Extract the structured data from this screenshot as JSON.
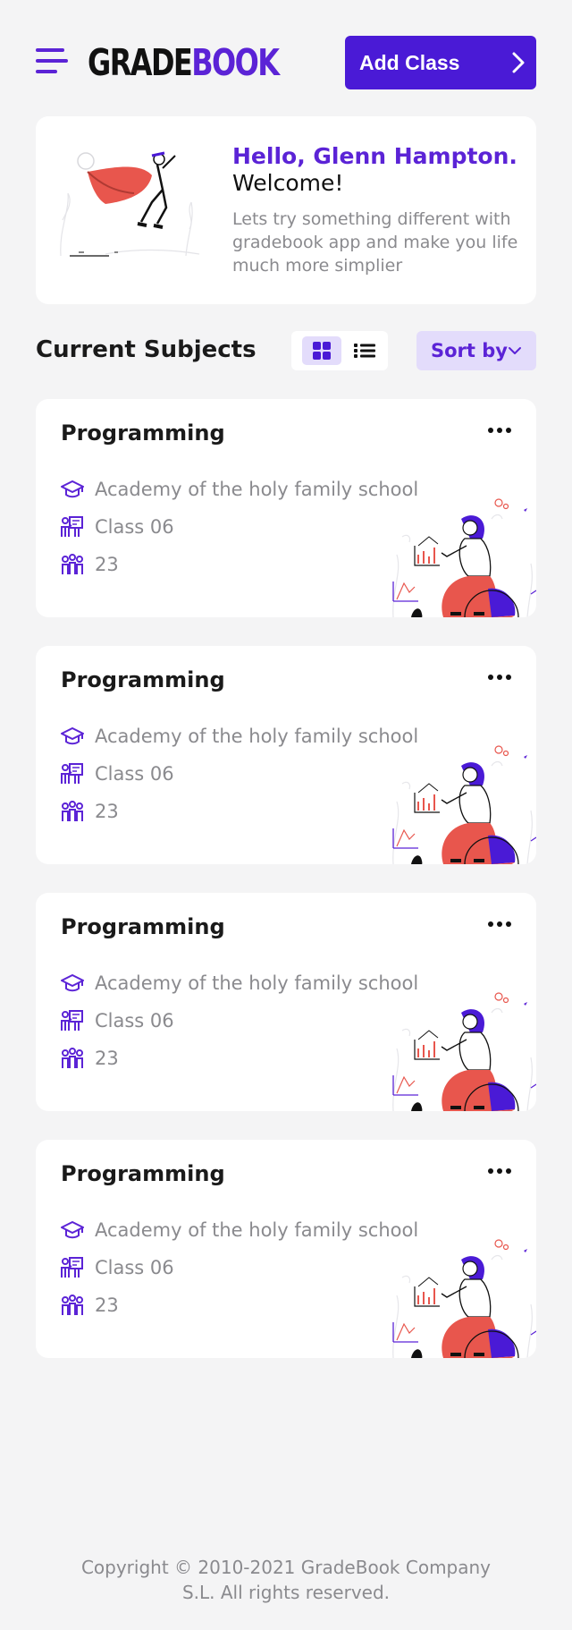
{
  "header": {
    "logo_part1": "GRADE",
    "logo_part2": "BOOK",
    "add_class_label": "Add Class"
  },
  "welcome": {
    "greeting": "Hello, Glenn Hampton.",
    "subtitle": "Welcome!",
    "description": "Lets try something different with gradebook app and make you life much more simplier"
  },
  "subjects": {
    "title": "Current Subjects",
    "sort_label": "Sort by",
    "active_view": "grid",
    "cards": [
      {
        "title": "Programming",
        "school": "Academy of the holy family school",
        "class": "Class 06",
        "students": "23"
      },
      {
        "title": "Programming",
        "school": "Academy of the holy family school",
        "class": "Class 06",
        "students": "23"
      },
      {
        "title": "Programming",
        "school": "Academy of the holy family school",
        "class": "Class 06",
        "students": "23"
      },
      {
        "title": "Programming",
        "school": "Academy of the holy family school",
        "class": "Class 06",
        "students": "23"
      }
    ]
  },
  "footer": {
    "line1": "Copyright © 2010-2021 GradeBook Company",
    "line2": "S.L. All rights reserved."
  },
  "icons": {
    "menu": "hamburger-menu-icon",
    "add_arrow": "chevron-right-icon",
    "grid": "grid-view-icon",
    "list": "list-view-icon",
    "sort": "chevron-down-icon",
    "more": "more-horizontal-icon",
    "school": "graduation-cap-icon",
    "class": "classroom-board-icon",
    "students": "students-group-icon"
  },
  "colors": {
    "brand": "#5b23d6",
    "button": "#4a1ad6",
    "accent_soft": "#e3dcfb",
    "background": "#f4f4f5",
    "muted_text": "#8a8a8e",
    "illustration_red": "#e8564d"
  }
}
